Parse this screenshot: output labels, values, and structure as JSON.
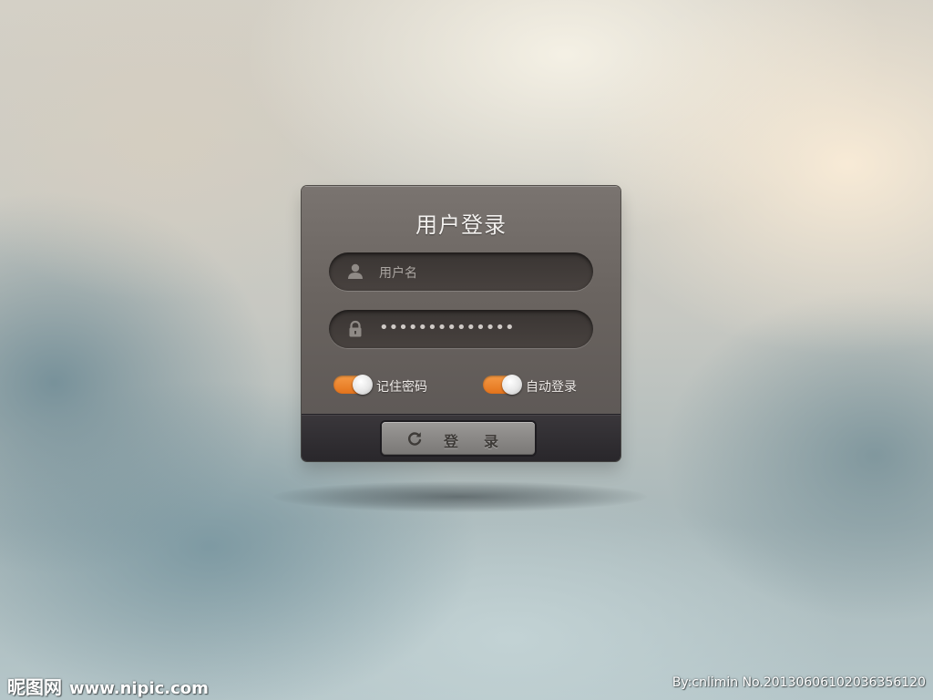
{
  "login_panel": {
    "title": "用户登录",
    "username_field": {
      "placeholder": "用户名",
      "icon": "user-icon"
    },
    "password_field": {
      "masked_value": "••••••••••••••",
      "icon": "lock-icon"
    },
    "remember_password": {
      "label": "记住密码",
      "state": "on"
    },
    "auto_login": {
      "label": "自动登录",
      "state": "on"
    },
    "login_button": {
      "label": "登录",
      "icon": "refresh-icon"
    }
  },
  "watermark": {
    "site_name": "昵图网",
    "site_url": "www.nipic.com",
    "credit": "By:cnlimin  No.20130606102036356120"
  },
  "colors": {
    "toggle_on": "#e3731c",
    "panel": "#6a6460",
    "panel_footer": "#29272b",
    "button": "#8a8886"
  }
}
